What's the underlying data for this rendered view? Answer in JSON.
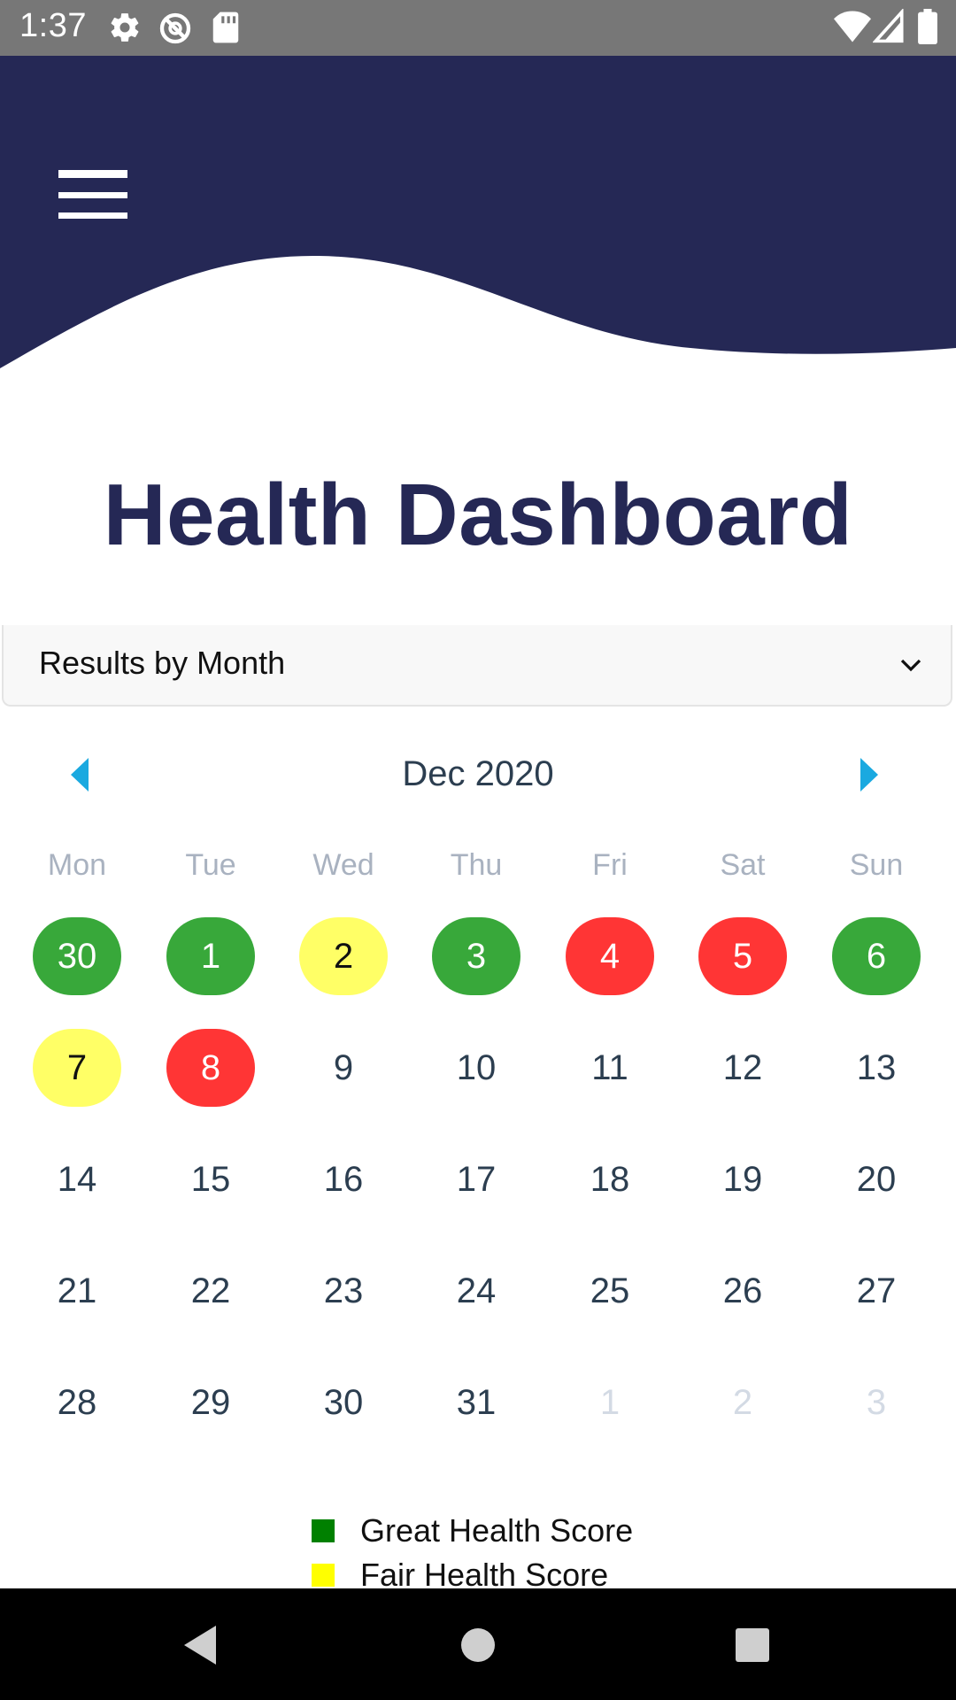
{
  "status_bar": {
    "time": "1:37",
    "left_icons": [
      "gear-icon",
      "no-sync-icon",
      "sd-card-icon"
    ],
    "right_icons": [
      "wifi-icon",
      "cell-signal-icon",
      "battery-icon"
    ]
  },
  "header": {
    "menu_icon": "hamburger-menu-icon",
    "background_color": "#252855"
  },
  "page": {
    "title": "Health Dashboard"
  },
  "dropdown": {
    "selected": "Results by Month",
    "icon": "chevron-down-icon"
  },
  "calendar": {
    "month_label": "Dec 2020",
    "prev_icon": "caret-left-icon",
    "next_icon": "caret-right-icon",
    "accent_color": "#1aa9e0",
    "weekdays": [
      "Mon",
      "Tue",
      "Wed",
      "Thu",
      "Fri",
      "Sat",
      "Sun"
    ],
    "weeks": [
      [
        {
          "day": "30",
          "status": "great"
        },
        {
          "day": "1",
          "status": "great"
        },
        {
          "day": "2",
          "status": "fair"
        },
        {
          "day": "3",
          "status": "great"
        },
        {
          "day": "4",
          "status": "poor"
        },
        {
          "day": "5",
          "status": "poor"
        },
        {
          "day": "6",
          "status": "great"
        }
      ],
      [
        {
          "day": "7",
          "status": "fair"
        },
        {
          "day": "8",
          "status": "poor"
        },
        {
          "day": "9",
          "status": "none"
        },
        {
          "day": "10",
          "status": "none"
        },
        {
          "day": "11",
          "status": "none"
        },
        {
          "day": "12",
          "status": "none"
        },
        {
          "day": "13",
          "status": "none"
        }
      ],
      [
        {
          "day": "14",
          "status": "none"
        },
        {
          "day": "15",
          "status": "none"
        },
        {
          "day": "16",
          "status": "none"
        },
        {
          "day": "17",
          "status": "none"
        },
        {
          "day": "18",
          "status": "none"
        },
        {
          "day": "19",
          "status": "none"
        },
        {
          "day": "20",
          "status": "none"
        }
      ],
      [
        {
          "day": "21",
          "status": "none"
        },
        {
          "day": "22",
          "status": "none"
        },
        {
          "day": "23",
          "status": "none"
        },
        {
          "day": "24",
          "status": "none"
        },
        {
          "day": "25",
          "status": "none"
        },
        {
          "day": "26",
          "status": "none"
        },
        {
          "day": "27",
          "status": "none"
        }
      ],
      [
        {
          "day": "28",
          "status": "none"
        },
        {
          "day": "29",
          "status": "none"
        },
        {
          "day": "30",
          "status": "none"
        },
        {
          "day": "31",
          "status": "none"
        },
        {
          "day": "1",
          "status": "other"
        },
        {
          "day": "2",
          "status": "other"
        },
        {
          "day": "3",
          "status": "other"
        }
      ]
    ],
    "status_colors": {
      "great": "#38a83a",
      "fair": "#ffff66",
      "poor": "#ff3535"
    }
  },
  "legend": {
    "items": [
      {
        "label": "Great Health Score",
        "color": "#008000"
      },
      {
        "label": "Fair Health Score",
        "color": "#ffff00"
      }
    ]
  },
  "nav_bar": {
    "icons": [
      "back-icon",
      "home-icon",
      "recents-icon"
    ]
  }
}
